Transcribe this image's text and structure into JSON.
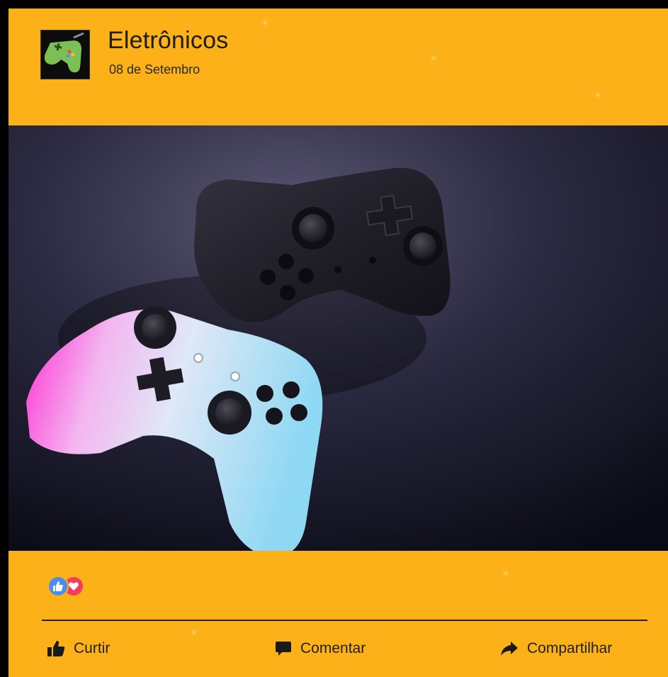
{
  "post": {
    "page_name": "Eletrônicos",
    "date": "08 de Setembro",
    "avatar_icon": "gamepad-icon",
    "photo_icon": "game-controllers-photo",
    "reactions": [
      {
        "name": "like-reaction-icon",
        "color": "#4c8cf2"
      },
      {
        "name": "love-reaction-icon",
        "color": "#ef3f5b"
      }
    ],
    "actions": {
      "like_label": "Curtir",
      "comment_label": "Comentar",
      "share_label": "Compartilhar"
    }
  },
  "colors": {
    "card_background": "#fcb119",
    "frame": "#000000",
    "text": "#1c1c1c"
  }
}
